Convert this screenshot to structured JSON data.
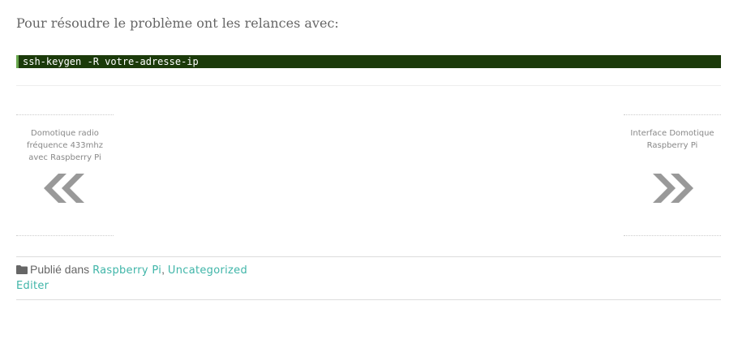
{
  "intro_text": "Pour résoudre le problème ont les relances avec:",
  "code": "ssh-keygen -R votre-adresse-ip",
  "navigation": {
    "previous": {
      "title": "Domotique radio fréquence 433mhz avec Raspberry Pi",
      "icon": "double-chevron-left-icon"
    },
    "next": {
      "title": "Interface Domotique Raspberry Pi",
      "icon": "double-chevron-right-icon"
    }
  },
  "meta": {
    "icon": "folder-icon",
    "published_in_label": "Publié dans",
    "categories": [
      "Raspberry Pi",
      "Uncategorized"
    ],
    "separator": ", ",
    "edit_label": "Editer"
  },
  "colors": {
    "link": "#3fb5a8",
    "code_background": "#1b3a0a",
    "code_border": "#6aa84f",
    "arrow": "#999999"
  }
}
